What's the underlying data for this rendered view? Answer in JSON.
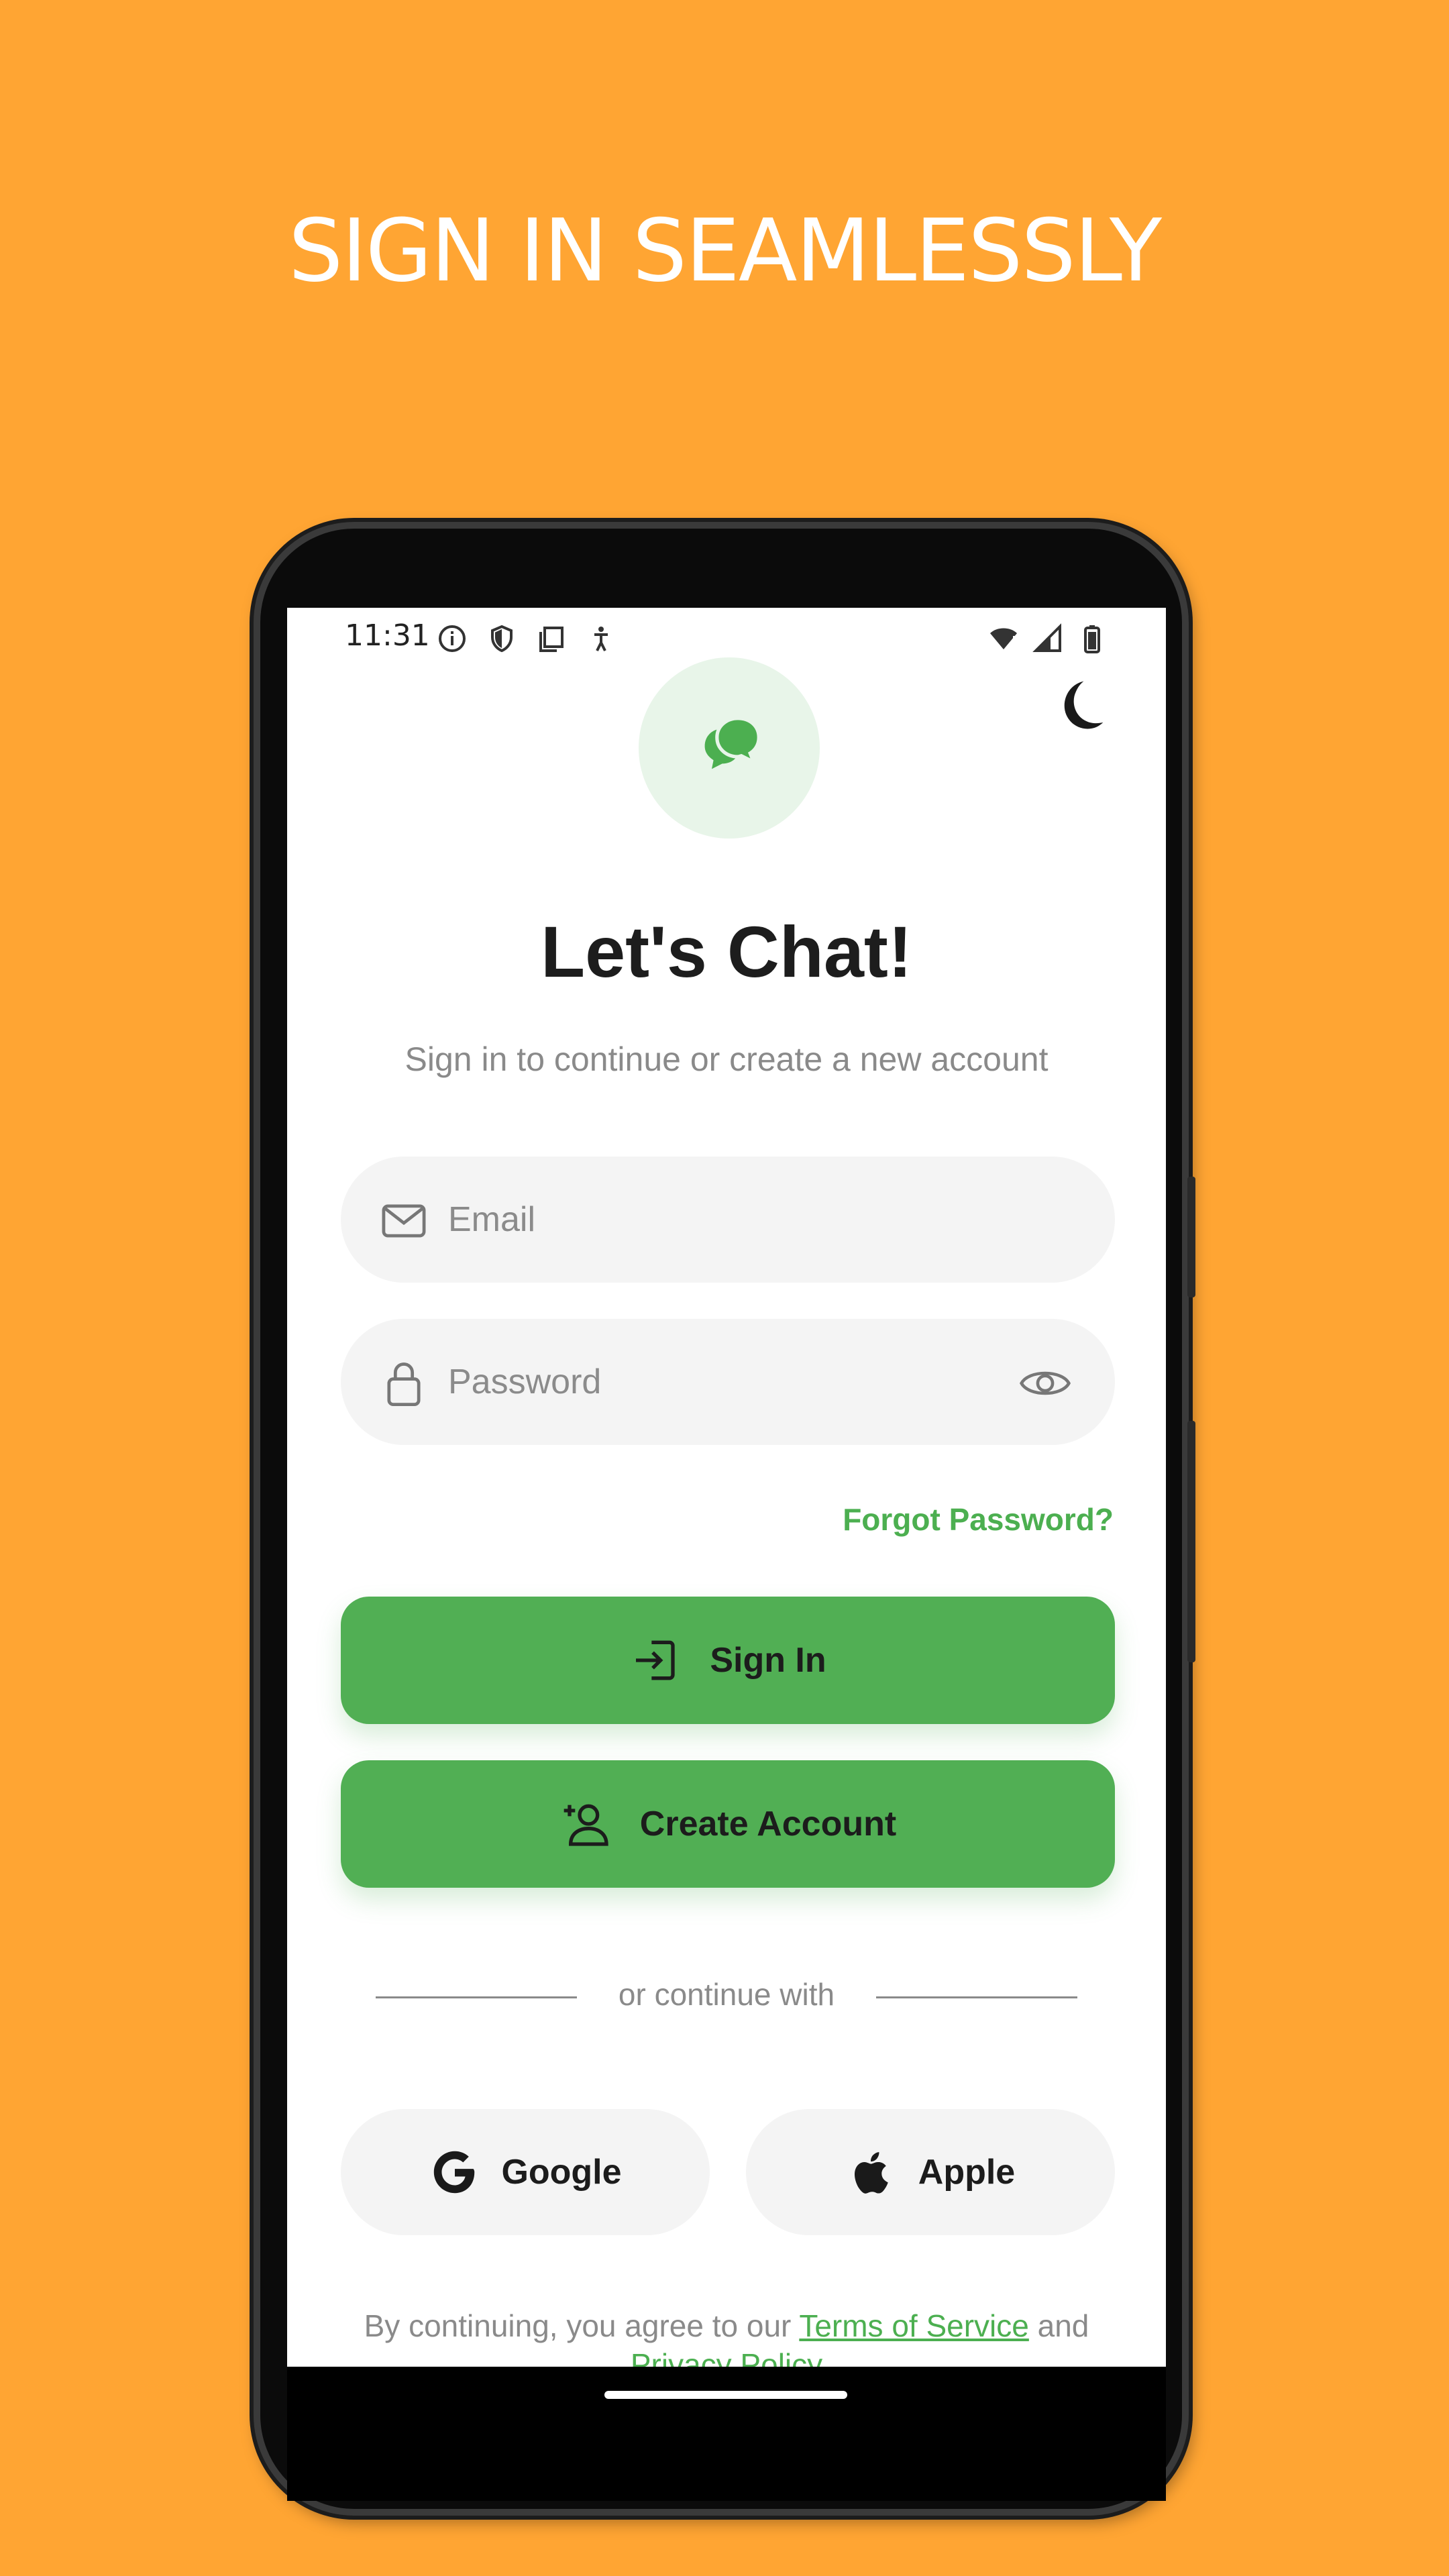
{
  "headline": "SIGN IN SEAMLESSLY",
  "colors": {
    "background": "#FFA533",
    "accent": "#4CAF50",
    "button": "#51AF54",
    "field": "#F4F4F4"
  },
  "status_bar": {
    "time": "11:31",
    "left_icons": [
      "info-icon",
      "shield-icon",
      "copy-icon",
      "accessibility-icon"
    ],
    "right_icons": [
      "wifi-alert-icon",
      "signal-icon",
      "battery-icon"
    ]
  },
  "app": {
    "logo_icon": "chat-bubbles-icon",
    "theme_toggle_icon": "moon-icon",
    "title": "Let's Chat!",
    "subtitle": "Sign in to continue or create a new account",
    "email": {
      "placeholder": "Email",
      "value": "",
      "icon": "mail-icon"
    },
    "password": {
      "placeholder": "Password",
      "value": "",
      "icon": "lock-icon",
      "toggle_icon": "eye-icon"
    },
    "forgot_password": "Forgot Password?",
    "sign_in": {
      "label": "Sign In",
      "icon": "login-icon"
    },
    "create_account": {
      "label": "Create Account",
      "icon": "add-person-icon"
    },
    "divider_text": "or continue with",
    "social": [
      {
        "label": "Google",
        "icon": "google-icon"
      },
      {
        "label": "Apple",
        "icon": "apple-icon"
      }
    ],
    "legal": {
      "prefix": "By continuing, you agree to our",
      "terms": "Terms of Service",
      "and": "and",
      "privacy": "Privacy Policy"
    }
  }
}
